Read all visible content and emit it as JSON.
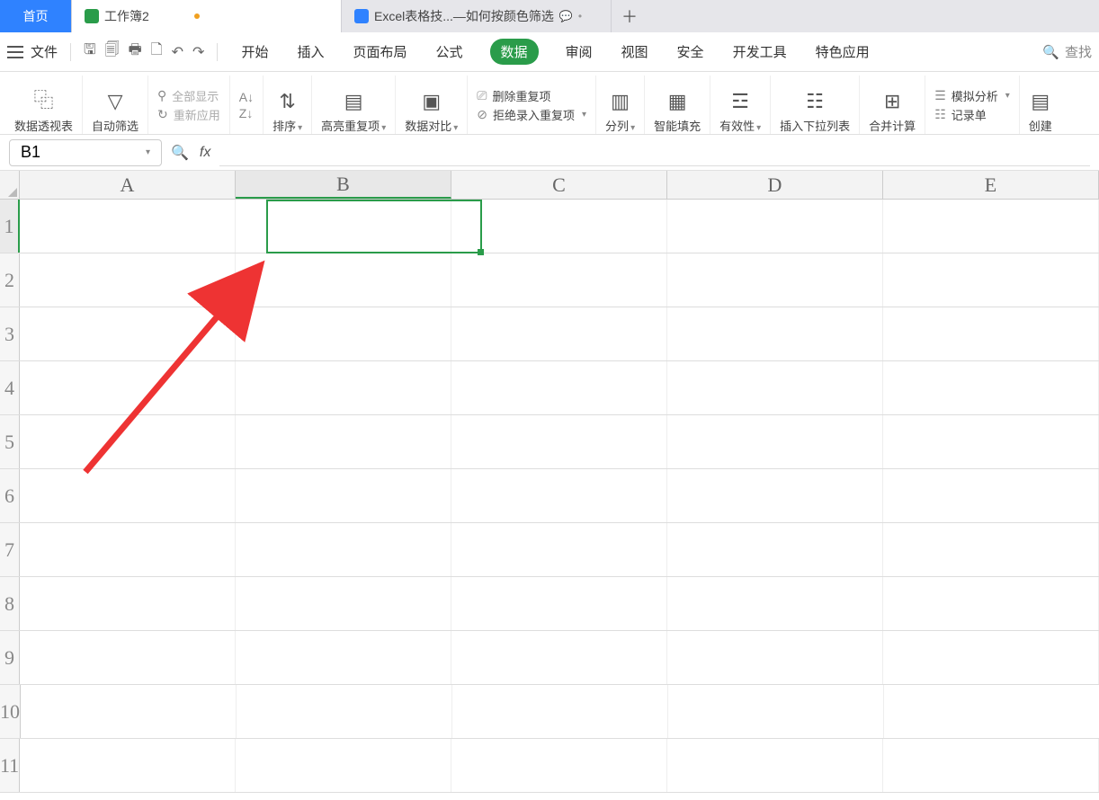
{
  "tabs": {
    "home": "首页",
    "workbook": {
      "label": "工作簿2",
      "modified": true
    },
    "doc": {
      "label": "Excel表格技...—如何按颜色筛选"
    }
  },
  "menubar": {
    "file": "文件",
    "items": [
      "开始",
      "插入",
      "页面布局",
      "公式",
      "数据",
      "审阅",
      "视图",
      "安全",
      "开发工具",
      "特色应用"
    ],
    "active_index": 4,
    "search": "查找"
  },
  "ribbon": {
    "pivot": "数据透视表",
    "filter": "自动筛选",
    "filter_opts": {
      "show_all": "全部显示",
      "reapply": "重新应用"
    },
    "sort": "排序",
    "sort_opts": {
      "asc": "A↓",
      "desc": "Z↓"
    },
    "highlight_dup": "高亮重复项",
    "compare": "数据对比",
    "dup_group": {
      "del_dup": "删除重复项",
      "reject_dup": "拒绝录入重复项"
    },
    "split_col": "分列",
    "smart_fill": "智能填充",
    "validity": "有效性",
    "dropdown_insert": "插入下拉列表",
    "consolidate": "合并计算",
    "sim_analysis": "模拟分析",
    "record_form": "记录单",
    "create": "创建"
  },
  "namebox": {
    "value": "B1"
  },
  "fx_label": "fx",
  "columns": [
    "A",
    "B",
    "C",
    "D",
    "E"
  ],
  "selected_col_index": 1,
  "rows": [
    "1",
    "2",
    "3",
    "4",
    "5",
    "6",
    "7",
    "8",
    "9",
    "10",
    "11"
  ],
  "selected_row_index": 0
}
